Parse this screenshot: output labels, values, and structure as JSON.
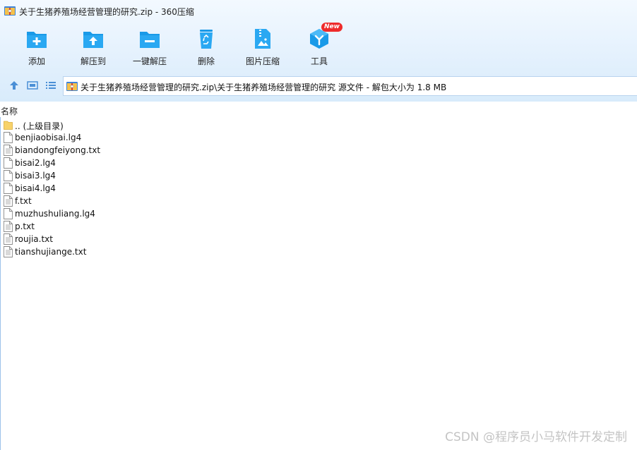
{
  "window": {
    "title": "关于生猪养殖场经营管理的研究.zip - 360压缩"
  },
  "toolbar": {
    "items": [
      {
        "label": "添加",
        "icon": "add-folder-icon"
      },
      {
        "label": "解压到",
        "icon": "extract-to-icon"
      },
      {
        "label": "一键解压",
        "icon": "one-click-extract-icon"
      },
      {
        "label": "删除",
        "icon": "recycle-bin-icon"
      },
      {
        "label": "图片压缩",
        "icon": "image-compress-icon"
      },
      {
        "label": "工具",
        "icon": "tools-cube-icon"
      }
    ],
    "new_badge": "New"
  },
  "navbar": {
    "path": "关于生猪养殖场经营管理的研究.zip\\关于生猪养殖场经营管理的研究 源文件 - 解包大小为 1.8 MB"
  },
  "list": {
    "column_name": "名称",
    "rows": [
      {
        "name": ".. (上级目录)",
        "type": "folder"
      },
      {
        "name": "benjiaobisai.lg4",
        "type": "file"
      },
      {
        "name": "biandongfeiyong.txt",
        "type": "text"
      },
      {
        "name": "bisai2.lg4",
        "type": "file"
      },
      {
        "name": "bisai3.lg4",
        "type": "file"
      },
      {
        "name": "bisai4.lg4",
        "type": "file"
      },
      {
        "name": "f.txt",
        "type": "text"
      },
      {
        "name": "muzhushuliang.lg4",
        "type": "file"
      },
      {
        "name": "p.txt",
        "type": "text"
      },
      {
        "name": "roujia.txt",
        "type": "text"
      },
      {
        "name": "tianshujiange.txt",
        "type": "text"
      }
    ]
  },
  "watermark": "CSDN @程序员小马软件开发定制",
  "colors": {
    "accent": "#1a9ae8",
    "toolbar_bg": "#e4f1fd",
    "badge": "#ee2b2b"
  }
}
